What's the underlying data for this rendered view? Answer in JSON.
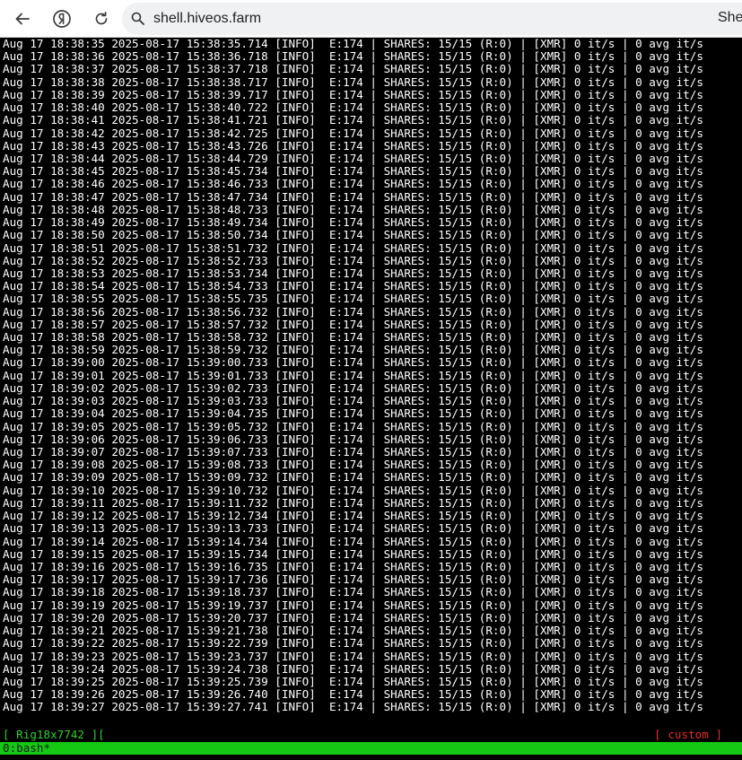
{
  "browser": {
    "address": "shell.hiveos.farm",
    "tab_title": "She"
  },
  "terminal": {
    "line_suffix": " [INFO]  E:174 | SHARES: 15/15 (R:0) | [XMR] 0 it/s | 0 avg it/s",
    "lines": [
      "Aug 17 18:38:35 2025-08-17 15:38:35.714",
      "Aug 17 18:38:36 2025-08-17 15:38:36.718",
      "Aug 17 18:38:37 2025-08-17 15:38:37.718",
      "Aug 17 18:38:38 2025-08-17 15:38:38.717",
      "Aug 17 18:38:39 2025-08-17 15:38:39.717",
      "Aug 17 18:38:40 2025-08-17 15:38:40.722",
      "Aug 17 18:38:41 2025-08-17 15:38:41.721",
      "Aug 17 18:38:42 2025-08-17 15:38:42.725",
      "Aug 17 18:38:43 2025-08-17 15:38:43.726",
      "Aug 17 18:38:44 2025-08-17 15:38:44.729",
      "Aug 17 18:38:45 2025-08-17 15:38:45.734",
      "Aug 17 18:38:46 2025-08-17 15:38:46.733",
      "Aug 17 18:38:47 2025-08-17 15:38:47.734",
      "Aug 17 18:38:48 2025-08-17 15:38:48.733",
      "Aug 17 18:38:49 2025-08-17 15:38:49.734",
      "Aug 17 18:38:50 2025-08-17 15:38:50.734",
      "Aug 17 18:38:51 2025-08-17 15:38:51.732",
      "Aug 17 18:38:52 2025-08-17 15:38:52.733",
      "Aug 17 18:38:53 2025-08-17 15:38:53.734",
      "Aug 17 18:38:54 2025-08-17 15:38:54.733",
      "Aug 17 18:38:55 2025-08-17 15:38:55.735",
      "Aug 17 18:38:56 2025-08-17 15:38:56.732",
      "Aug 17 18:38:57 2025-08-17 15:38:57.732",
      "Aug 17 18:38:58 2025-08-17 15:38:58.732",
      "Aug 17 18:38:59 2025-08-17 15:38:59.732",
      "Aug 17 18:39:00 2025-08-17 15:39:00.733",
      "Aug 17 18:39:01 2025-08-17 15:39:01.733",
      "Aug 17 18:39:02 2025-08-17 15:39:02.733",
      "Aug 17 18:39:03 2025-08-17 15:39:03.733",
      "Aug 17 18:39:04 2025-08-17 15:39:04.735",
      "Aug 17 18:39:05 2025-08-17 15:39:05.732",
      "Aug 17 18:39:06 2025-08-17 15:39:06.733",
      "Aug 17 18:39:07 2025-08-17 15:39:07.733",
      "Aug 17 18:39:08 2025-08-17 15:39:08.733",
      "Aug 17 18:39:09 2025-08-17 15:39:09.732",
      "Aug 17 18:39:10 2025-08-17 15:39:10.732",
      "Aug 17 18:39:11 2025-08-17 15:39:11.732",
      "Aug 17 18:39:12 2025-08-17 15:39:12.734",
      "Aug 17 18:39:13 2025-08-17 15:39:13.733",
      "Aug 17 18:39:14 2025-08-17 15:39:14.734",
      "Aug 17 18:39:15 2025-08-17 15:39:15.734",
      "Aug 17 18:39:16 2025-08-17 15:39:16.735",
      "Aug 17 18:39:17 2025-08-17 15:39:17.736",
      "Aug 17 18:39:18 2025-08-17 15:39:18.737",
      "Aug 17 18:39:19 2025-08-17 15:39:19.737",
      "Aug 17 18:39:20 2025-08-17 15:39:20.737",
      "Aug 17 18:39:21 2025-08-17 15:39:21.738",
      "Aug 17 18:39:22 2025-08-17 15:39:22.739",
      "Aug 17 18:39:23 2025-08-17 15:39:23.737",
      "Aug 17 18:39:24 2025-08-17 15:39:24.738",
      "Aug 17 18:39:25 2025-08-17 15:39:25.739",
      "Aug 17 18:39:26 2025-08-17 15:39:26.740",
      "Aug 17 18:39:27 2025-08-17 15:39:27.741"
    ]
  },
  "tmux": {
    "session_left": "[ Rig18x7742 ][",
    "session_right": "[ custom ]",
    "window": "0:bash*",
    "status_color": "#14c814"
  },
  "icons": {
    "back": "arrow-left-icon",
    "brand": "yandex-logo-icon",
    "reload": "reload-icon",
    "site": "site-settings-icon"
  }
}
